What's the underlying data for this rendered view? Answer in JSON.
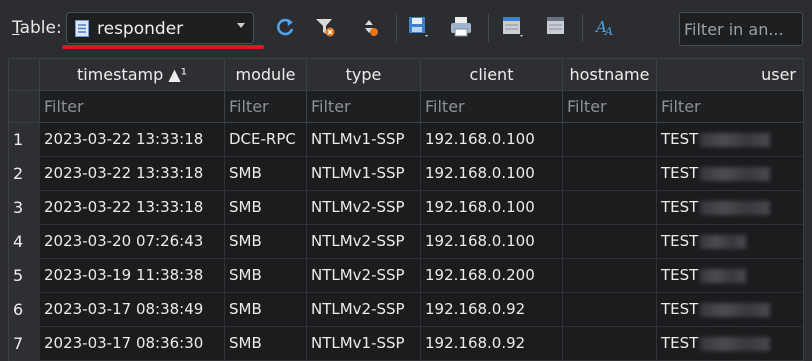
{
  "toolbar": {
    "table_label_u": "T",
    "table_label_rest": "able:",
    "selected_table": "responder",
    "filter_placeholder": "Filter in an...",
    "icons": [
      "refresh-icon",
      "clear-filters-icon",
      "sort-icon",
      "save-table-icon",
      "print-icon",
      "new-record-icon",
      "delete-record-icon",
      "font-icon"
    ],
    "accent": "#e5141e"
  },
  "grid": {
    "columns": [
      {
        "label": "timestamp ▲¹"
      },
      {
        "label": "module"
      },
      {
        "label": "type"
      },
      {
        "label": "client"
      },
      {
        "label": "hostname"
      },
      {
        "label": "user"
      }
    ],
    "filter_placeholder": "Filter",
    "rows": [
      {
        "num": "1",
        "timestamp": "2023-03-22 13:33:18",
        "module": "DCE-RPC",
        "type": "NTLMv1-SSP",
        "client": "192.168.0.100",
        "hostname": "",
        "user": "TEST"
      },
      {
        "num": "2",
        "timestamp": "2023-03-22 13:33:18",
        "module": "SMB",
        "type": "NTLMv1-SSP",
        "client": "192.168.0.100",
        "hostname": "",
        "user": "TEST"
      },
      {
        "num": "3",
        "timestamp": "2023-03-22 13:33:18",
        "module": "SMB",
        "type": "NTLMv2-SSP",
        "client": "192.168.0.100",
        "hostname": "",
        "user": "TEST"
      },
      {
        "num": "4",
        "timestamp": "2023-03-20 07:26:43",
        "module": "SMB",
        "type": "NTLMv2-SSP",
        "client": "192.168.0.100",
        "hostname": "",
        "user": "TEST"
      },
      {
        "num": "5",
        "timestamp": "2023-03-19 11:38:38",
        "module": "SMB",
        "type": "NTLMv2-SSP",
        "client": "192.168.0.200",
        "hostname": "",
        "user": "TEST"
      },
      {
        "num": "6",
        "timestamp": "2023-03-17 08:38:49",
        "module": "SMB",
        "type": "NTLMv2-SSP",
        "client": "192.168.0.92",
        "hostname": "",
        "user": "TEST"
      },
      {
        "num": "7",
        "timestamp": "2023-03-17 08:36:30",
        "module": "SMB",
        "type": "NTLMv1-SSP",
        "client": "192.168.0.92",
        "hostname": "",
        "user": "TEST"
      }
    ]
  }
}
